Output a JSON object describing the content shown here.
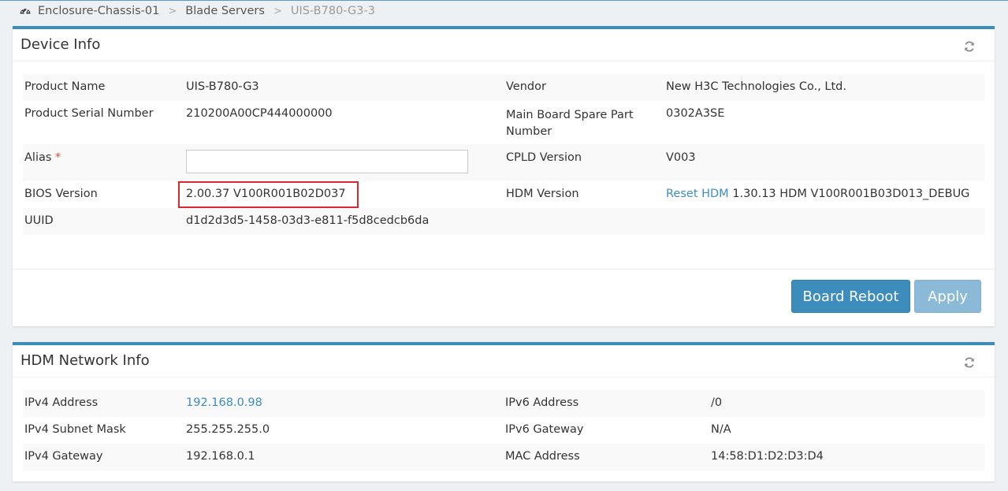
{
  "breadcrumb": {
    "items": [
      "Enclosure-Chassis-01",
      "Blade Servers",
      "UIS-B780-G3-3"
    ],
    "separator": ">"
  },
  "device_info": {
    "title": "Device Info",
    "rows": [
      {
        "label1": "Product Name",
        "value1": "UIS-B780-G3",
        "label2": "Vendor",
        "value2": "New H3C Technologies Co., Ltd."
      },
      {
        "label1": "Product Serial Number",
        "value1": "210200A00CP444000000",
        "label2": "Main Board Spare Part Number",
        "value2": "0302A3SE"
      },
      {
        "label1": "Alias",
        "required_mark": "*",
        "value1": "",
        "label2": "CPLD Version",
        "value2": "V003"
      },
      {
        "label1": "BIOS Version",
        "value1": "2.00.37 V100R001B02D037",
        "label2": "HDM Version",
        "link2": "Reset HDM",
        "value2": "1.30.13 HDM V100R001B03D013_DEBUG"
      },
      {
        "label1": "UUID",
        "value1": "d1d2d3d5-1458-03d3-e811-f5d8cedcb6da",
        "label2": "",
        "value2": ""
      }
    ],
    "buttons": {
      "reboot": "Board Reboot",
      "apply": "Apply"
    }
  },
  "network_info": {
    "title": "HDM Network Info",
    "rows": [
      {
        "label1": "IPv4 Address",
        "value1": "192.168.0.98",
        "label2": "IPv6 Address",
        "value2": "/0"
      },
      {
        "label1": "IPv4 Subnet Mask",
        "value1": "255.255.255.0",
        "label2": "IPv6 Gateway",
        "value2": "N/A"
      },
      {
        "label1": "IPv4 Gateway",
        "value1": "192.168.0.1",
        "label2": "MAC Address",
        "value2": "14:58:D1:D2:D3:D4"
      }
    ]
  },
  "icons": {
    "breadcrumb": "dashboard-icon",
    "refresh": "refresh-icon"
  },
  "colors": {
    "accent": "#3c8dbc",
    "highlight": "#d9292e",
    "required": "#dd4b39"
  }
}
